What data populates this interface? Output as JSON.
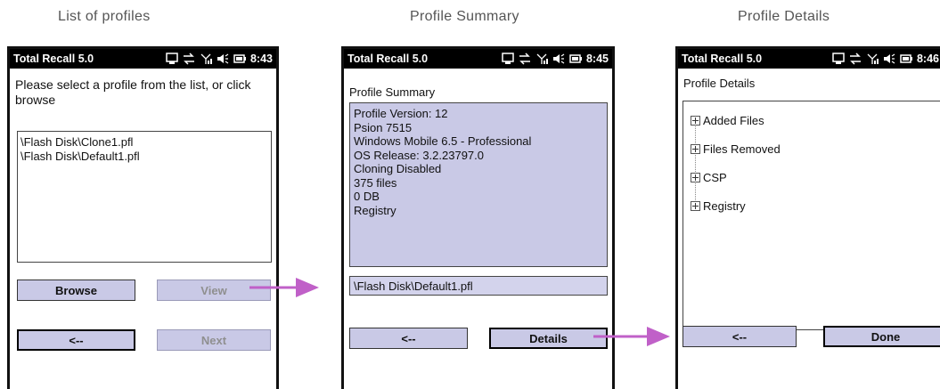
{
  "captions": [
    "List of profiles",
    "Profile Summary",
    "Profile Details"
  ],
  "status": {
    "app_title": "Total Recall 5.0",
    "times": [
      "8:43",
      "8:45",
      "8:46"
    ]
  },
  "screen1": {
    "prompt": "Please select a profile from the list, or click browse",
    "profiles": [
      "\\Flash Disk\\Clone1.pfl",
      "\\Flash Disk\\Default1.pfl"
    ],
    "browse": "Browse",
    "view": "View",
    "back": "<--",
    "next": "Next"
  },
  "screen2": {
    "heading": "Profile Summary",
    "summary": [
      "Profile Version: 12",
      "Psion 7515",
      "Windows Mobile 6.5 - Professional",
      "OS Release: 3.2.23797.0",
      "Cloning Disabled",
      "375 files",
      "0 DB",
      "Registry"
    ],
    "path": "\\Flash Disk\\Default1.pfl",
    "back": "<--",
    "details": "Details"
  },
  "screen3": {
    "heading": "Profile Details",
    "tree": [
      "Added Files",
      "Files Removed",
      "CSP",
      "Registry"
    ],
    "back": "<--",
    "done": "Done"
  },
  "colors": {
    "button": "#c9c9e6",
    "arrow": "#c060c8",
    "statusbar": "#000000"
  }
}
